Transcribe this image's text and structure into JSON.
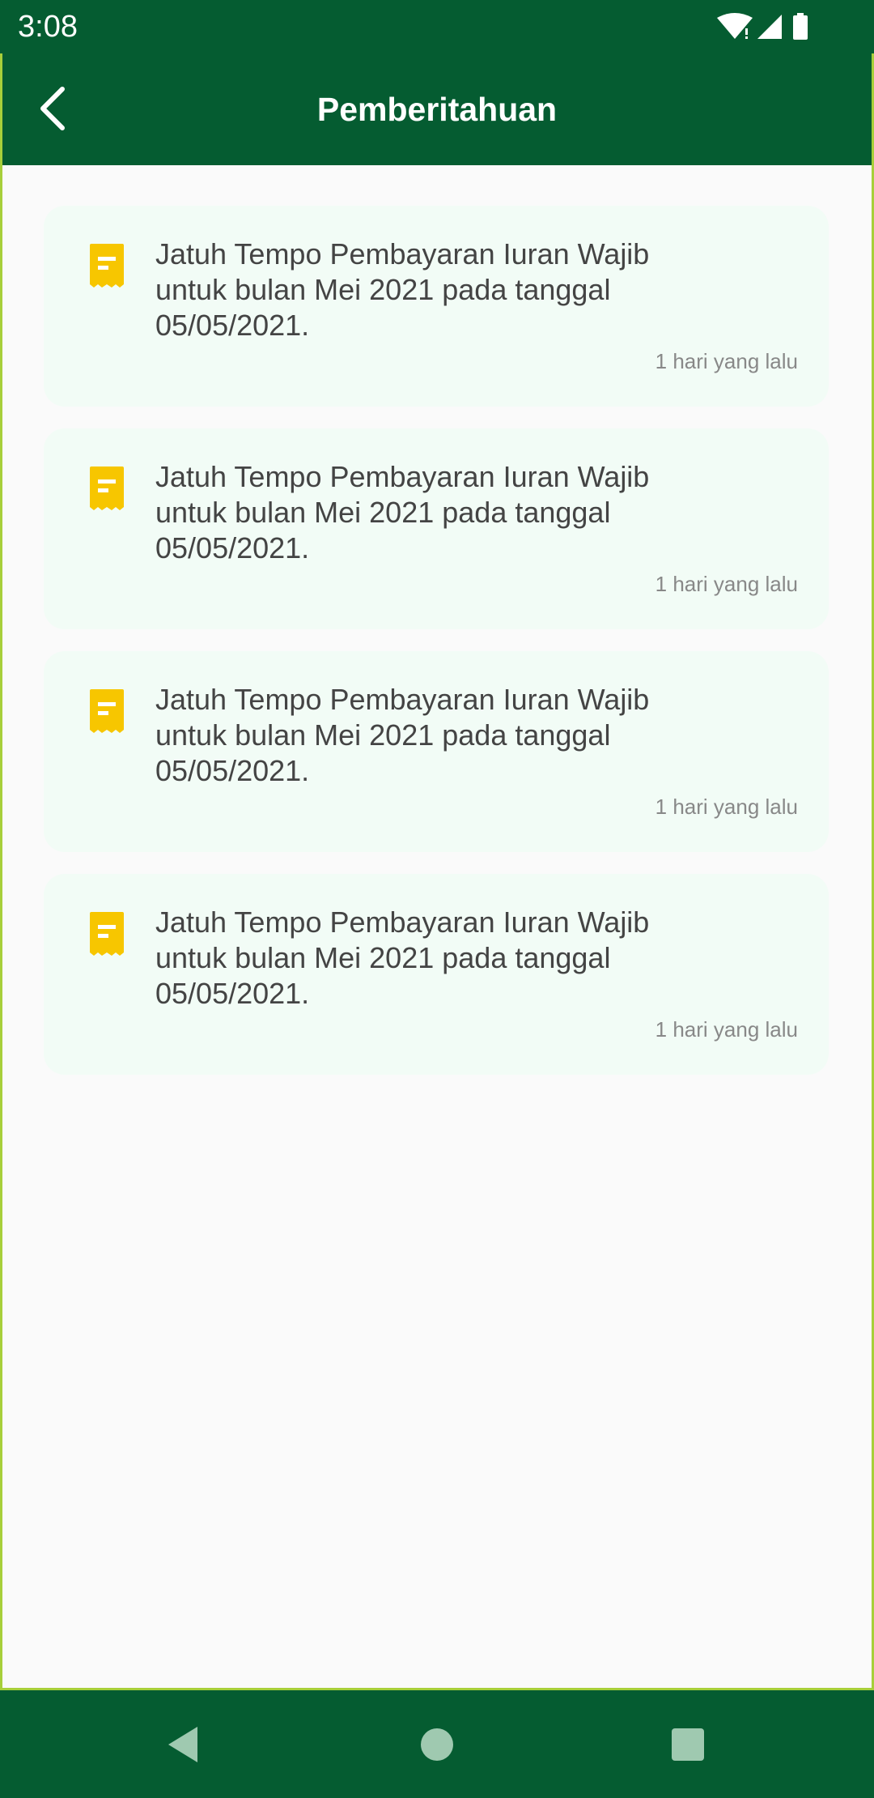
{
  "status_bar": {
    "time": "3:08",
    "icons": [
      "wifi-icon",
      "signal-icon",
      "battery-icon"
    ]
  },
  "app_bar": {
    "title": "Pemberitahuan",
    "back_icon": "back-arrow-icon"
  },
  "notifications": [
    {
      "icon": "receipt-icon",
      "message": "Jatuh Tempo Pembayaran Iuran Wajib untuk bulan Mei 2021 pada tanggal 05/05/2021.",
      "time": "1 hari yang lalu"
    },
    {
      "icon": "receipt-icon",
      "message": "Jatuh Tempo Pembayaran Iuran Wajib untuk bulan Mei 2021 pada tanggal 05/05/2021.",
      "time": "1 hari yang lalu"
    },
    {
      "icon": "receipt-icon",
      "message": "Jatuh Tempo Pembayaran Iuran Wajib untuk bulan Mei 2021 pada tanggal 05/05/2021.",
      "time": "1 hari yang lalu"
    },
    {
      "icon": "receipt-icon",
      "message": "Jatuh Tempo Pembayaran Iuran Wajib untuk bulan Mei 2021 pada tanggal 05/05/2021.",
      "time": "1 hari yang lalu"
    }
  ],
  "nav_bar": {
    "buttons": [
      "nav-back-icon",
      "nav-home-icon",
      "nav-recents-icon"
    ]
  },
  "colors": {
    "primary": "#055c31",
    "accent_border": "#a7cf3a",
    "card_background": "#f2fcf6",
    "icon_yellow": "#f7c600"
  }
}
